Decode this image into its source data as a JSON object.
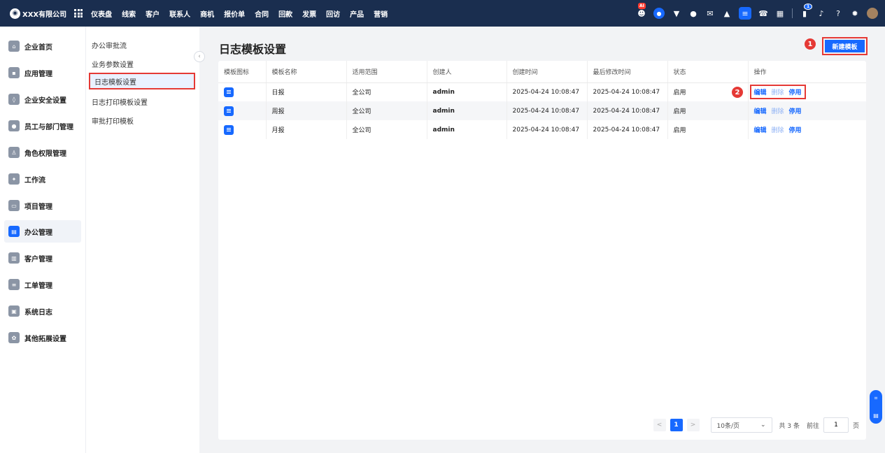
{
  "topbar": {
    "company": "XXX有限公司",
    "nav": [
      "仪表盘",
      "线索",
      "客户",
      "联系人",
      "商机",
      "报价单",
      "合同",
      "回款",
      "发票",
      "回访",
      "产品",
      "营销"
    ],
    "ai_badge": "AI",
    "notification_count": "1"
  },
  "sidebar": {
    "items": [
      {
        "label": "企业首页",
        "icon": "home-icon"
      },
      {
        "label": "应用管理",
        "icon": "apps-icon"
      },
      {
        "label": "企业安全设置",
        "icon": "shield-icon"
      },
      {
        "label": "员工与部门管理",
        "icon": "users-icon"
      },
      {
        "label": "角色权限管理",
        "icon": "role-icon"
      },
      {
        "label": "工作流",
        "icon": "workflow-icon"
      },
      {
        "label": "项目管理",
        "icon": "folder-icon"
      },
      {
        "label": "办公管理",
        "icon": "office-icon"
      },
      {
        "label": "客户管理",
        "icon": "customer-icon"
      },
      {
        "label": "工单管理",
        "icon": "ticket-icon"
      },
      {
        "label": "系统日志",
        "icon": "log-icon"
      },
      {
        "label": "其他拓展设置",
        "icon": "settings-icon"
      }
    ],
    "active_index": 7
  },
  "submenu": {
    "items": [
      "办公审批流",
      "业务参数设置",
      "日志模板设置",
      "日志打印模板设置",
      "审批打印模板"
    ],
    "active_index": 2
  },
  "main": {
    "title": "日志模板设置",
    "new_button": "新建模板",
    "step1": "1",
    "step2": "2",
    "table": {
      "headers": [
        "模板图标",
        "模板名称",
        "适用范围",
        "创建人",
        "创建时间",
        "最后修改时间",
        "状态",
        "操作"
      ],
      "rows": [
        {
          "name": "日报",
          "scope": "全公司",
          "creator": "admin",
          "created": "2025-04-24 10:08:47",
          "modified": "2025-04-24 10:08:47",
          "status": "启用",
          "actions": [
            "编辑",
            "删除",
            "停用"
          ]
        },
        {
          "name": "周报",
          "scope": "全公司",
          "creator": "admin",
          "created": "2025-04-24 10:08:47",
          "modified": "2025-04-24 10:08:47",
          "status": "启用",
          "actions": [
            "编辑",
            "删除",
            "停用"
          ]
        },
        {
          "name": "月报",
          "scope": "全公司",
          "creator": "admin",
          "created": "2025-04-24 10:08:47",
          "modified": "2025-04-24 10:08:47",
          "status": "启用",
          "actions": [
            "编辑",
            "删除",
            "停用"
          ]
        }
      ]
    },
    "pagination": {
      "prev": "<",
      "current": "1",
      "next": ">",
      "page_size": "10条/页",
      "total": "共 3 条",
      "goto_label": "前往",
      "goto_value": "1",
      "unit": "页"
    }
  },
  "colors": {
    "primary": "#1769ff",
    "topbar": "#1a2e4f",
    "highlight": "#e53935"
  }
}
